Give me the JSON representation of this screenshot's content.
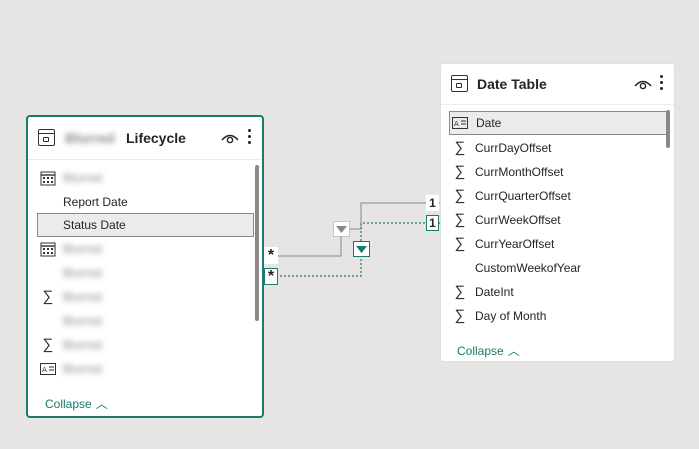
{
  "lifecycle_table": {
    "title_prefix_blurred": "Blurred",
    "title": "Lifecycle",
    "fields": [
      {
        "name": "Blurred",
        "icon": "calendar-icon",
        "blurred": true,
        "selected": false
      },
      {
        "name": "Report Date",
        "icon": "",
        "blurred": false,
        "selected": false
      },
      {
        "name": "Status Date",
        "icon": "",
        "blurred": false,
        "selected": true
      },
      {
        "name": "Blurred",
        "icon": "calendar-icon",
        "blurred": true,
        "selected": false
      },
      {
        "name": "Blurred",
        "icon": "",
        "blurred": true,
        "selected": false
      },
      {
        "name": "Blurred",
        "icon": "sigma-icon",
        "blurred": true,
        "selected": false
      },
      {
        "name": "Blurred",
        "icon": "",
        "blurred": true,
        "selected": false
      },
      {
        "name": "Blurred",
        "icon": "sigma-icon",
        "blurred": true,
        "selected": false
      },
      {
        "name": "Blurred",
        "icon": "text-field-icon",
        "blurred": true,
        "selected": false
      }
    ],
    "collapse_label": "Collapse",
    "collapse_glyph": "︿"
  },
  "date_table": {
    "title": "Date Table",
    "fields": [
      {
        "name": "Date",
        "icon": "text-field-icon",
        "selected": true
      },
      {
        "name": "CurrDayOffset",
        "icon": "sigma-icon",
        "selected": false
      },
      {
        "name": "CurrMonthOffset",
        "icon": "sigma-icon",
        "selected": false
      },
      {
        "name": "CurrQuarterOffset",
        "icon": "sigma-icon",
        "selected": false
      },
      {
        "name": "CurrWeekOffset",
        "icon": "sigma-icon",
        "selected": false
      },
      {
        "name": "CurrYearOffset",
        "icon": "sigma-icon",
        "selected": false
      },
      {
        "name": "CustomWeekofYear",
        "icon": "",
        "selected": false
      },
      {
        "name": "DateInt",
        "icon": "sigma-icon",
        "selected": false
      },
      {
        "name": "Day of Month",
        "icon": "sigma-icon",
        "selected": false
      }
    ],
    "collapse_label": "Collapse",
    "collapse_glyph": "︿"
  },
  "relationships": {
    "one_label": "1",
    "many_label": "*",
    "active_color": "#8a8886",
    "inactive_color": "#1a7a6b"
  },
  "colors": {
    "accent": "#1a7a6b",
    "canvas": "#e6e5e4"
  }
}
